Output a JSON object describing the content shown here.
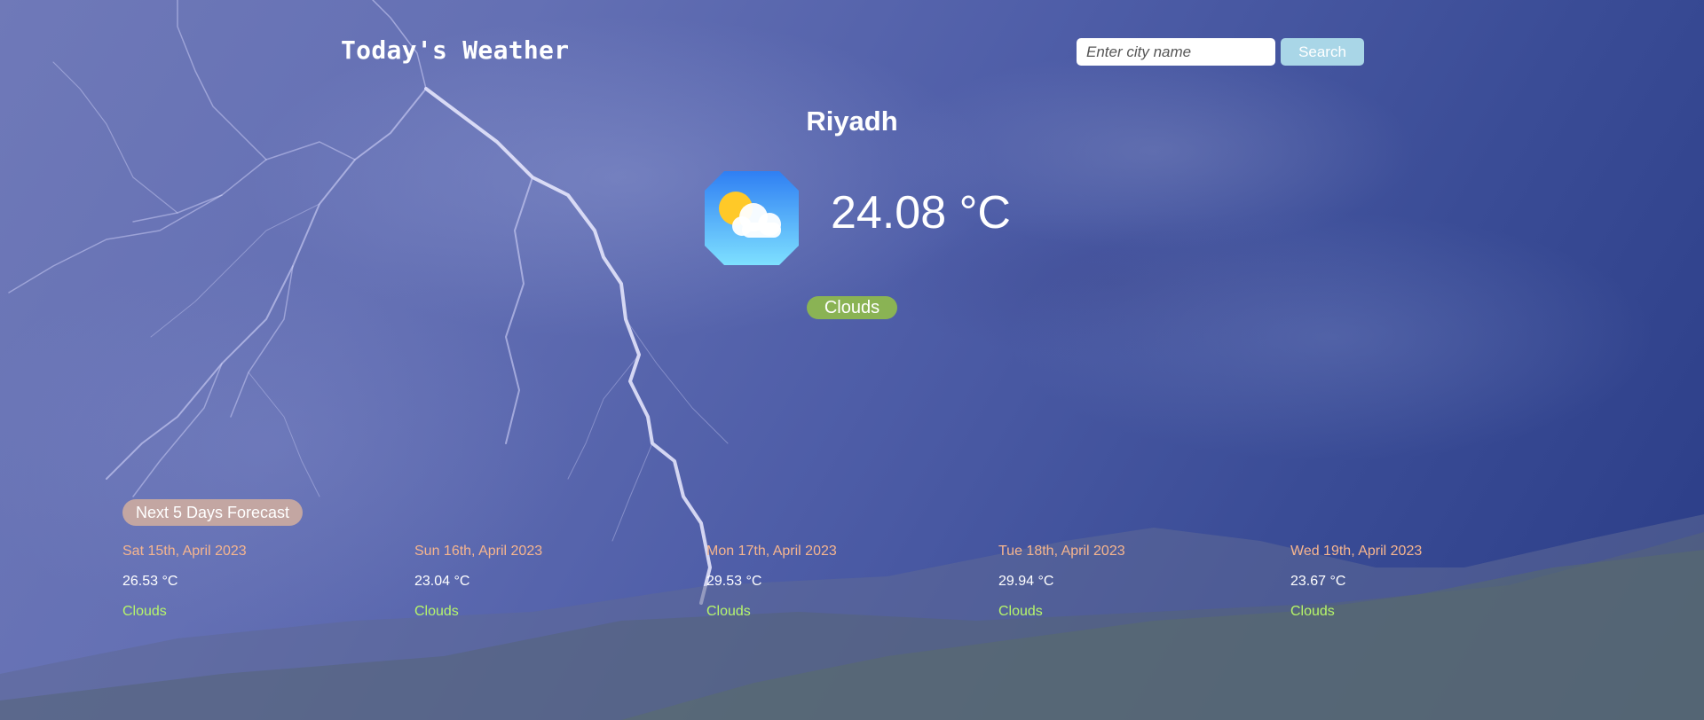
{
  "header": {
    "title": "Today's Weather"
  },
  "search": {
    "placeholder": "Enter city name",
    "value": "",
    "button_label": "Search"
  },
  "current": {
    "city": "Riyadh",
    "temperature": "24.08 °C",
    "condition": "Clouds",
    "icon": "partly-cloudy-icon"
  },
  "forecast": {
    "heading": "Next 5 Days Forecast",
    "days": [
      {
        "date": "Sat 15th, April 2023",
        "temp": "26.53 °C",
        "condition": "Clouds"
      },
      {
        "date": "Sun 16th, April 2023",
        "temp": "23.04 °C",
        "condition": "Clouds"
      },
      {
        "date": "Mon 17th, April 2023",
        "temp": "29.53 °C",
        "condition": "Clouds"
      },
      {
        "date": "Tue 18th, April 2023",
        "temp": "29.94 °C",
        "condition": "Clouds"
      },
      {
        "date": "Wed 19th, April 2023",
        "temp": "23.67 °C",
        "condition": "Clouds"
      }
    ]
  },
  "colors": {
    "background": "#5a67ad",
    "search_button": "#a9d6e7",
    "condition_badge": "#8ab354",
    "forecast_badge": "#c3a6a2",
    "forecast_date": "#f6b58e",
    "forecast_condition": "#b6f56a"
  }
}
